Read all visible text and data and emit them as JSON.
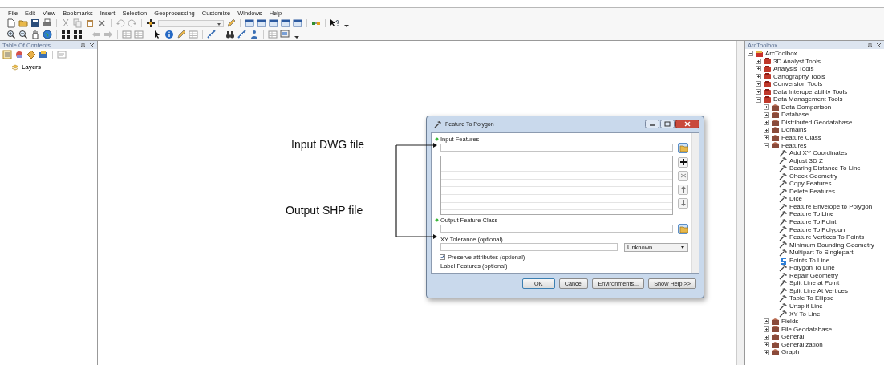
{
  "menu_bar": [
    "File",
    "Edit",
    "View",
    "Bookmarks",
    "Insert",
    "Selection",
    "Geoprocessing",
    "Customize",
    "Windows",
    "Help"
  ],
  "table_of_contents": {
    "title": "Table Of Contents",
    "items": [
      {
        "label": "Layers"
      }
    ]
  },
  "annotations": [
    {
      "text": "Input DWG file"
    },
    {
      "text": "Output SHP file"
    }
  ],
  "dialog": {
    "title": "Feature To Polygon",
    "parameters": [
      {
        "kind": "multivalue",
        "label": "Input Features",
        "required": true
      },
      {
        "kind": "dataset",
        "label": "Output Feature Class",
        "required": true
      },
      {
        "kind": "linear_unit",
        "label": "XY Tolerance (optional)",
        "required": false,
        "unit": "Unknown"
      },
      {
        "kind": "checkbox",
        "label": "Preserve attributes (optional)",
        "checked": true
      },
      {
        "kind": "heading",
        "label": "Label Features (optional)",
        "required": false
      }
    ],
    "buttons": [
      "OK",
      "Cancel",
      "Environments...",
      "Show Help >>"
    ]
  },
  "toolbox": {
    "title": "ArcToolbox",
    "tree": [
      {
        "kind": "root",
        "label": "ArcToolbox",
        "expanded": true,
        "children": [
          {
            "kind": "toolbox",
            "label": "3D Analyst Tools",
            "expanded": false
          },
          {
            "kind": "toolbox",
            "label": "Analysis Tools",
            "expanded": false
          },
          {
            "kind": "toolbox",
            "label": "Cartography Tools",
            "expanded": false
          },
          {
            "kind": "toolbox",
            "label": "Conversion Tools",
            "expanded": false
          },
          {
            "kind": "toolbox",
            "label": "Data Interoperability Tools",
            "expanded": false
          },
          {
            "kind": "toolbox",
            "label": "Data Management Tools",
            "expanded": true,
            "children": [
              {
                "kind": "toolset",
                "label": "Data Comparison",
                "expanded": false
              },
              {
                "kind": "toolset",
                "label": "Database",
                "expanded": false
              },
              {
                "kind": "toolset",
                "label": "Distributed Geodatabase",
                "expanded": false
              },
              {
                "kind": "toolset",
                "label": "Domains",
                "expanded": false
              },
              {
                "kind": "toolset",
                "label": "Feature Class",
                "expanded": false
              },
              {
                "kind": "toolset",
                "label": "Features",
                "expanded": true,
                "children": [
                  {
                    "kind": "tool",
                    "label": "Add XY Coordinates"
                  },
                  {
                    "kind": "tool",
                    "label": "Adjust 3D Z"
                  },
                  {
                    "kind": "tool",
                    "label": "Bearing Distance To Line"
                  },
                  {
                    "kind": "tool",
                    "label": "Check Geometry"
                  },
                  {
                    "kind": "tool",
                    "label": "Copy Features"
                  },
                  {
                    "kind": "tool",
                    "label": "Delete Features"
                  },
                  {
                    "kind": "tool",
                    "label": "Dice"
                  },
                  {
                    "kind": "tool",
                    "label": "Feature Envelope to Polygon"
                  },
                  {
                    "kind": "tool",
                    "label": "Feature To Line"
                  },
                  {
                    "kind": "tool",
                    "label": "Feature To Point"
                  },
                  {
                    "kind": "tool",
                    "label": "Feature To Polygon"
                  },
                  {
                    "kind": "tool",
                    "label": "Feature Vertices To Points"
                  },
                  {
                    "kind": "tool",
                    "label": "Minimum Bounding Geometry"
                  },
                  {
                    "kind": "tool",
                    "label": "Multipart To Singlepart"
                  },
                  {
                    "kind": "script",
                    "label": "Points To Line"
                  },
                  {
                    "kind": "tool",
                    "label": "Polygon To Line"
                  },
                  {
                    "kind": "tool",
                    "label": "Repair Geometry"
                  },
                  {
                    "kind": "tool",
                    "label": "Split Line at Point"
                  },
                  {
                    "kind": "tool",
                    "label": "Split Line At Vertices"
                  },
                  {
                    "kind": "tool",
                    "label": "Table To Ellipse"
                  },
                  {
                    "kind": "tool",
                    "label": "Unsplit Line"
                  },
                  {
                    "kind": "tool",
                    "label": "XY To Line"
                  }
                ]
              },
              {
                "kind": "toolset",
                "label": "Fields",
                "expanded": false
              },
              {
                "kind": "toolset",
                "label": "File Geodatabase",
                "expanded": false
              },
              {
                "kind": "toolset",
                "label": "General",
                "expanded": false
              },
              {
                "kind": "toolset",
                "label": "Generalization",
                "expanded": false
              },
              {
                "kind": "toolset",
                "label": "Graph",
                "expanded": false
              }
            ]
          }
        ]
      }
    ]
  }
}
